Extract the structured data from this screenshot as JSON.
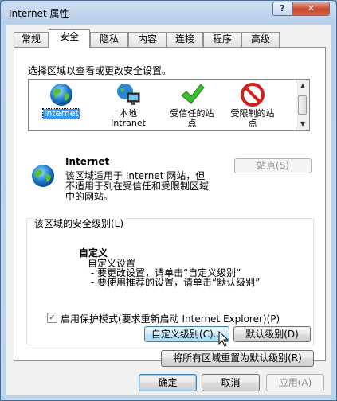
{
  "window": {
    "title": "Internet 属性",
    "help_label": "?",
    "close_label": "✕"
  },
  "tabs": [
    "常规",
    "安全",
    "隐私",
    "内容",
    "连接",
    "程序",
    "高级"
  ],
  "active_tab": "安全",
  "zone_prompt": "选择区域以查看或更改安全设置。",
  "zones": [
    {
      "label": "Internet",
      "icon": "globe-icon"
    },
    {
      "label": "本地\nIntranet",
      "icon": "intranet-icon"
    },
    {
      "label": "受信任的站\n点",
      "icon": "checkmark-icon"
    },
    {
      "label": "受限制的站\n点",
      "icon": "no-entry-icon"
    }
  ],
  "selected_zone": {
    "name": "Internet",
    "description_lines": [
      "该区域适用于 Internet 网站，但",
      "不适用于列在受信任和受限制区域",
      "中的网站。"
    ],
    "sites_button": "站点(S)"
  },
  "security_level": {
    "group_label": "该区域的安全级别(L)",
    "level_name": "自定义",
    "detail_lines": [
      "自定义设置",
      " - 要更改设置，请单击“自定义级别”",
      " - 要使用推荐的设置，请单击“默认级别”"
    ]
  },
  "protected_mode": {
    "label": "启用保护模式(要求重新启动 Internet Explorer)(P)",
    "checked": true,
    "check_glyph": "✓"
  },
  "buttons": {
    "custom_level": "自定义级别(C)...",
    "default_level": "默认级别(D)",
    "reset_all": "将所有区域重置为默认级别(R)",
    "ok": "确定",
    "cancel": "取消",
    "apply": "应用(A)"
  },
  "colors": {
    "accent": "#3399ff",
    "title_bg": "#b9d0ea",
    "close": "#c7452d"
  }
}
